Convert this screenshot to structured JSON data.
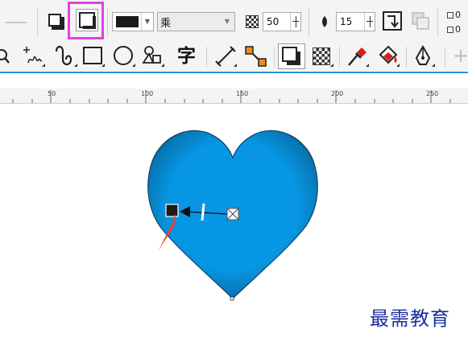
{
  "property_bar": {
    "shadow_color": "#1d1a18",
    "merge_mode": "乘",
    "opacity_value": "50",
    "feather_value": "15",
    "stack_icons": [
      "0",
      "0"
    ]
  },
  "toolbox": {
    "tools": [
      "crop-tool",
      "freehand-tool",
      "artistic-media-tool",
      "rectangle-tool",
      "ellipse-tool",
      "polygon-tool",
      "text-tool",
      "dimension-tool",
      "connector-tool",
      "drop-shadow-tool",
      "transparency-tool",
      "eyedropper-tool",
      "interactive-fill-tool",
      "smart-fill-tool"
    ],
    "text_tool_label": "字"
  },
  "ruler": {
    "labels": [
      "50",
      "100",
      "150",
      "200",
      "250"
    ]
  },
  "canvas": {
    "heart_fill": "#0796e3",
    "highlight_color": "#e43fe4"
  },
  "watermark": {
    "text": "最需教育"
  }
}
